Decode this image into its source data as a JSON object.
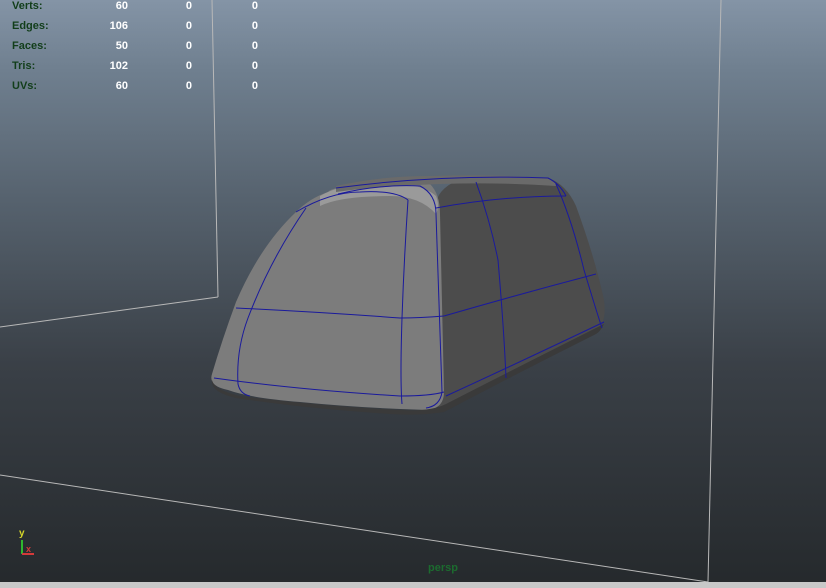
{
  "hud": {
    "rows": [
      {
        "label": "Verts:",
        "v1": "60",
        "v2": "0",
        "v3": "0"
      },
      {
        "label": "Edges:",
        "v1": "106",
        "v2": "0",
        "v3": "0"
      },
      {
        "label": "Faces:",
        "v1": "50",
        "v2": "0",
        "v3": "0"
      },
      {
        "label": "Tris:",
        "v1": "102",
        "v2": "0",
        "v3": "0"
      },
      {
        "label": "UVs:",
        "v1": "60",
        "v2": "0",
        "v3": "0"
      }
    ]
  },
  "viewport": {
    "camera": "persp",
    "axis_y": "y",
    "axis_x": "x"
  },
  "colors": {
    "hud_label": "#123e1a",
    "hud_value": "#ffffff",
    "wireframe": "#1a1a9c",
    "camera_label": "#1c6b2f",
    "axis_y": "#d6d629",
    "axis_x": "#d43a3a",
    "grid_line": "#b8b8b8"
  },
  "icons": {
    "axis_gizmo": "axis-gizmo-icon"
  }
}
